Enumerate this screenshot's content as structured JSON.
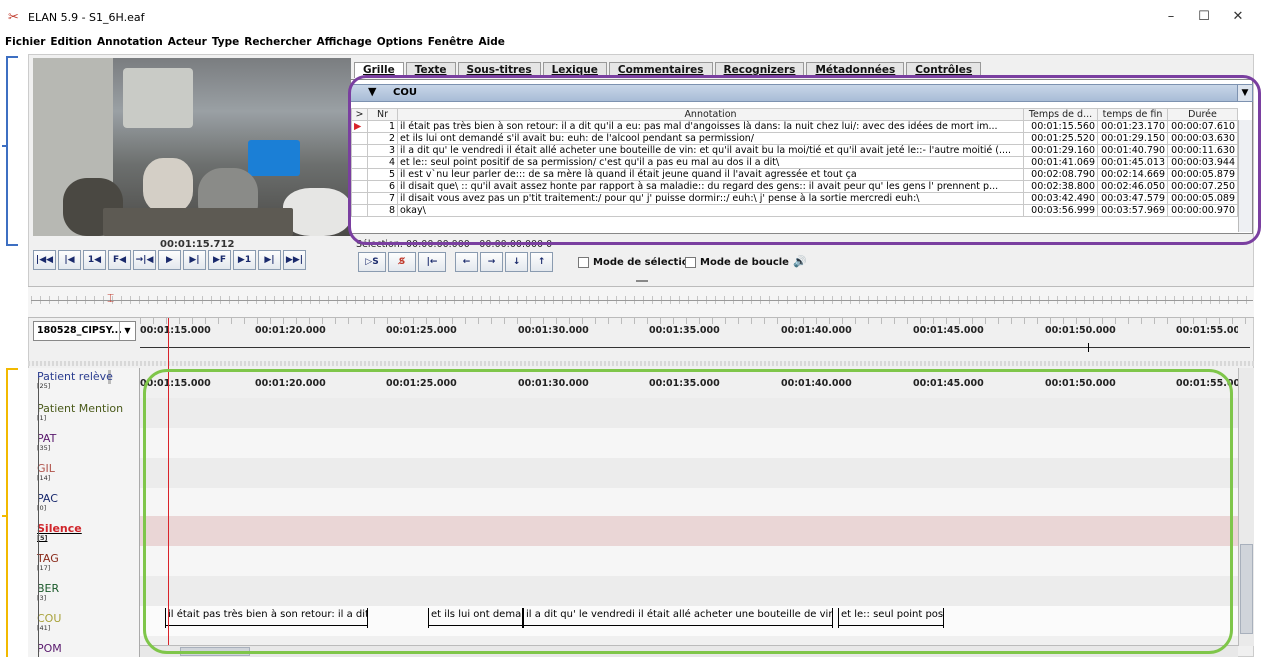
{
  "window": {
    "title": "ELAN 5.9 - S1_6H.eaf",
    "minimize": "–",
    "maximize": "☐",
    "close": "✕"
  },
  "menu": [
    "Fichier",
    "Edition",
    "Annotation",
    "Acteur",
    "Type",
    "Rechercher",
    "Affichage",
    "Options",
    "Fenêtre",
    "Aide"
  ],
  "video": {
    "time": "00:01:15.712"
  },
  "tabs": [
    "Grille",
    "Texte",
    "Sous-titres",
    "Lexique",
    "Commentaires",
    "Recognizers",
    "Métadonnées",
    "Contrôles"
  ],
  "grid": {
    "tier": "COU",
    "headers": [
      "Nr",
      "Annotation",
      "Temps de d...",
      "temps de fin",
      "Durée"
    ],
    "rows": [
      [
        "1",
        "il était pas très bien à son retour: il a dit qu'il a eu: pas mal d'angoisses là dans: la nuit chez lui/: avec des idées de mort im...",
        "00:01:15.560",
        "00:01:23.170",
        "00:00:07.610"
      ],
      [
        "2",
        "et ils lui ont demandé s'il avait bu: euh: de l'alcool pendant sa permission/",
        "00:01:25.520",
        "00:01:29.150",
        "00:00:03.630"
      ],
      [
        "3",
        "il a dit qu' le vendredi il était allé acheter une bouteille de vin: et qu'il avait bu la moi/tié et qu'il avait jeté le::- l'autre moitié (....",
        "00:01:29.160",
        "00:01:40.790",
        "00:00:11.630"
      ],
      [
        "4",
        "et le:: seul point positif de sa permission/ c'est qu'il a pas eu mal au dos il a dit\\",
        "00:01:41.069",
        "00:01:45.013",
        "00:00:03.944"
      ],
      [
        "5",
        "il est v`nu leur parler de::: de sa mère là quand il était jeune quand il l'avait agressée et tout ça",
        "00:02:08.790",
        "00:02:14.669",
        "00:00:05.879"
      ],
      [
        "6",
        "il disait que\\ :: qu'il avait assez honte par rapport à sa maladie:: du regard des gens:: il avait peur qu' les gens l' prennent p...",
        "00:02:38.800",
        "00:02:46.050",
        "00:00:07.250"
      ],
      [
        "7",
        "il disait vous avez pas un p'tit traitement:/ pour qu' j' puisse dormir::/ euh:\\ j' pense à la sortie mercredi euh:\\",
        "00:03:42.490",
        "00:03:47.579",
        "00:00:05.089"
      ],
      [
        "8",
        "okay\\",
        "00:03:56.999",
        "00:03:57.969",
        "00:00:00.970"
      ]
    ],
    "selection": "Sélection: 00:00:00.000 - 00:00:00.000  0"
  },
  "modes": {
    "selection": "Mode de sélection",
    "loop": "Mode de boucle"
  },
  "media": {
    "name": "180528_CIPSY..."
  },
  "ticks": [
    "00:01:15.000",
    "00:01:20.000",
    "00:01:25.000",
    "00:01:30.000",
    "00:01:35.000",
    "00:01:40.000",
    "00:01:45.000",
    "00:01:50.000",
    "00:01:55.000"
  ],
  "tiers": [
    {
      "name": "Patient relève",
      "count": "[25]",
      "color": "#2a3c8f"
    },
    {
      "name": "Patient Mention",
      "count": "[1]",
      "color": "#4a5a1a"
    },
    {
      "name": "PAT",
      "count": "[35]",
      "color": "#5a1a6e"
    },
    {
      "name": "GIL",
      "count": "[14]",
      "color": "#b0524a"
    },
    {
      "name": "PAC",
      "count": "[0]",
      "color": "#1a2a6e"
    },
    {
      "name": "Silence",
      "count": "[5]",
      "color": "#d0242a"
    },
    {
      "name": "TAG",
      "count": "[17]",
      "color": "#8a2a1a"
    },
    {
      "name": "BER",
      "count": "[3]",
      "color": "#1a5a2a"
    },
    {
      "name": "COU",
      "count": "[41]",
      "color": "#a8a23a"
    },
    {
      "name": "POM",
      "count": "",
      "color": "#5a1a6e"
    }
  ],
  "annotations": [
    {
      "text": "il était pas très bien à son retour: il a dit"
    },
    {
      "text": "et ils lui ont dema"
    },
    {
      "text": "il a dit qu' le vendredi il était allé acheter une bouteille de vin:"
    },
    {
      "text": "et le:: seul point pos"
    }
  ]
}
